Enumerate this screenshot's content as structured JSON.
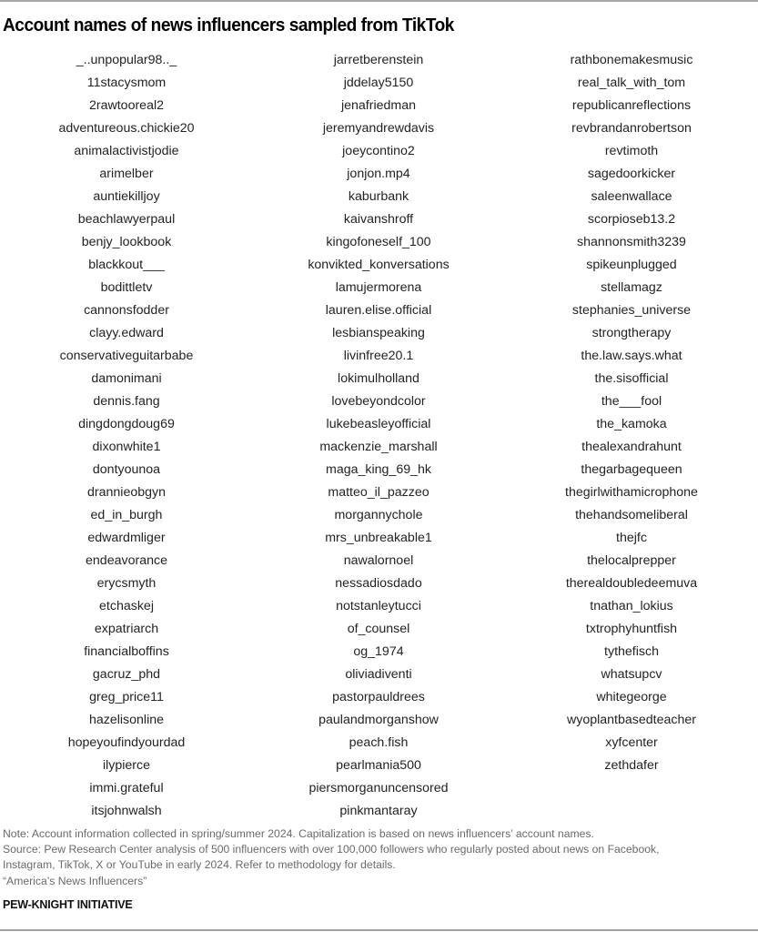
{
  "title": "Account names of news influencers sampled from TikTok",
  "columns": [
    {
      "names": [
        "_..unpopular98.._",
        "11stacysmom",
        "2rawtooreal2",
        "adventureous.chickie20",
        "animalactivistjodie",
        "arimelber",
        "auntiekilljoy",
        "beachlawyerpaul",
        "benjy_lookbook",
        "blackkout___",
        "bodittletv",
        "cannonsfodder",
        "clayy.edward",
        "conservativeguitarbabe",
        "damonimani",
        "dennis.fang",
        "dingdongdoug69",
        "dixonwhite1",
        "dontyounoa",
        "drannieobgyn",
        "ed_in_burgh",
        "edwardmliger",
        "endeavorance",
        "erycsmyth",
        "etchaskej",
        "expatriarch",
        "financialboffins",
        "gacruz_phd",
        "greg_price11",
        "hazelisonline",
        "hopeyoufindyourdad",
        "ilypierce",
        "immi.grateful",
        "itsjohnwalsh"
      ]
    },
    {
      "names": [
        "jarretberenstein",
        "jddelay5150",
        "jenafriedman",
        "jeremyandrewdavis",
        "joeycontino2",
        "jonjon.mp4",
        "kaburbank",
        "kaivanshroff",
        "kingofoneself_100",
        "konvikted_konversations",
        "lamujermorena",
        "lauren.elise.official",
        "lesbianspeaking",
        "livinfree20.1",
        "lokimulholland",
        "lovebeyondcolor",
        "lukebeasleyofficial",
        "mackenzie_marshall",
        "maga_king_69_hk",
        "matteo_il_pazzeo",
        "morgannychole",
        "mrs_unbreakable1",
        "nawalornoel",
        "nessadiosdado",
        "notstanleytucci",
        "of_counsel",
        "og_1974",
        "oliviadiventi",
        "pastorpauldrees",
        "paulandmorganshow",
        "peach.fish",
        "pearlmania500",
        "piersmorganuncensored",
        "pinkmantaray"
      ]
    },
    {
      "names": [
        "rathbonemakesmusic",
        "real_talk_with_tom",
        "republicanreflections",
        "revbrandanrobertson",
        "revtimoth",
        "sagedoorkicker",
        "saleenwallace",
        "scorpioseb13.2",
        "shannonsmith3239",
        "spikeunplugged",
        "stellamagz",
        "stephanies_universe",
        "strongtherapy",
        "the.law.says.what",
        "the.sisofficial",
        "the___fool",
        "the_kamoka",
        "thealexandrahunt",
        "thegarbagequeen",
        "thegirlwithamicrophone",
        "thehandsomeliberal",
        "thejfc",
        "thelocalprepper",
        "therealdoubledeemuva",
        "tnathan_lokius",
        "txtrophyhuntfish",
        "tythefisch",
        "whatsupcv",
        "whitegeorge",
        "wyoplantbasedteacher",
        "xyfcenter",
        "zethdafer"
      ]
    }
  ],
  "footer": {
    "note": "Note: Account information collected in spring/summer 2024. Capitalization is based on news influencers’ account names.",
    "source_line1": "Source: Pew Research Center analysis of 500 influencers with over 100,000 followers who regularly posted about news on Facebook,",
    "source_line2": "Instagram, TikTok, X or YouTube in early 2024. Refer to methodology for details.",
    "report": "“America’s News Influencers”",
    "brand": "PEW-KNIGHT INITIATIVE"
  },
  "colors": {
    "title": "#000000",
    "body_text": "#232323",
    "note_text": "#6a6a6a",
    "rule": "#a8a8a8"
  }
}
